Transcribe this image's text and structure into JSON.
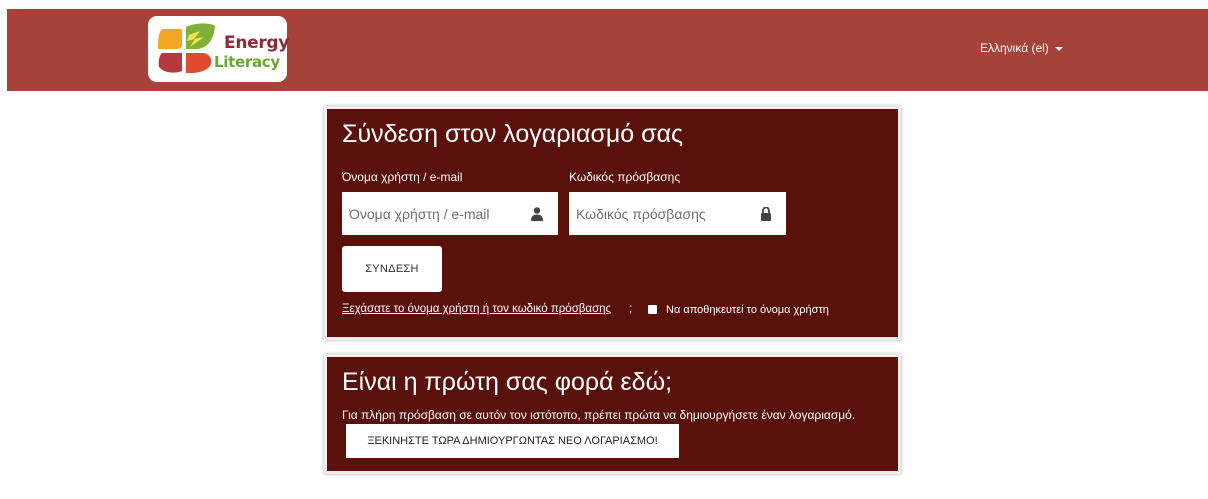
{
  "header": {
    "logo": {
      "word1": "Energy",
      "word2": "Literacy"
    },
    "language": "Ελληνικά (el)"
  },
  "login": {
    "title": "Σύνδεση στον λογαριασμό σας",
    "username_label": "Όνομα χρήστη / e-mail",
    "username_placeholder": "Όνομα χρήστη / e-mail",
    "username_value": "",
    "password_label": "Κωδικός πρόσβασης",
    "password_placeholder": "Κωδικός πρόσβασης",
    "password_value": "",
    "submit_label": "ΣΥΝΔΕΣΗ",
    "forgot_link": "Ξεχάσατε το όνομα χρήστη ή τον κωδικό πρόσβασης",
    "forgot_suffix": ";",
    "remember_label": "Να αποθηκευτεί το όνομα χρήστη",
    "remember_checked": false,
    "username_icon": "user-icon",
    "password_icon": "lock-icon"
  },
  "signup": {
    "title": "Είναι η πρώτη σας φορά εδώ;",
    "text": "Για πλήρη πρόσβαση σε αυτόν τον ιστότοπο, πρέπει πρώτα να δημιουργήσετε έναν λογαριασμό.",
    "button_label": "ΞΕΚΙΝΗΣΤΕ ΤΩΡΑ ΔΗΜΙΟΥΡΓΩΝΤΑΣ ΝΕΟ ΛΟΓΑΡΙΑΣΜΟ!"
  },
  "colors": {
    "header_bg": "#a5433a",
    "card_bg": "#5b110b",
    "logo_energy": "#8e2a3a",
    "logo_literacy": "#6aa631"
  }
}
